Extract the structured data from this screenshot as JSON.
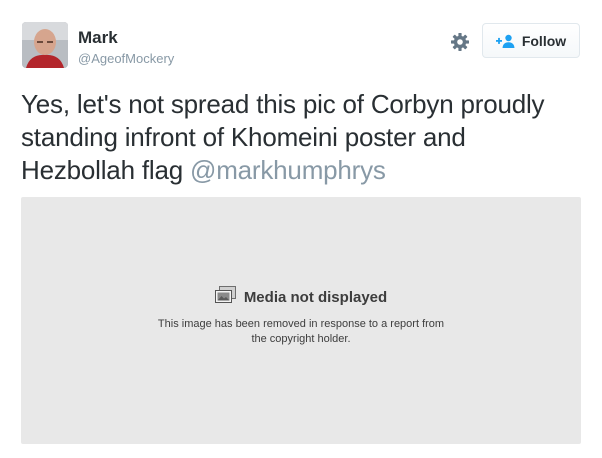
{
  "author": {
    "display_name": "Mark",
    "screen_name": "@AgeofMockery",
    "avatar": "user-avatar-photo"
  },
  "actions": {
    "settings_icon": "gear-icon",
    "follow_label": "Follow",
    "follow_icon": "add-user-icon"
  },
  "tweet": {
    "text": "Yes, let's not spread this pic of Corbyn proudly standing infront of Khomeini poster and Hezbollah flag ",
    "mention": "@markhumphrys"
  },
  "media": {
    "icon": "photos-icon",
    "title": "Media not displayed",
    "description": "This image has been removed in response to a report from the copyright holder."
  },
  "colors": {
    "text": "#292f33",
    "muted": "#8899a6",
    "accent": "#1da1f2",
    "media_bg": "#e8e8e8"
  }
}
